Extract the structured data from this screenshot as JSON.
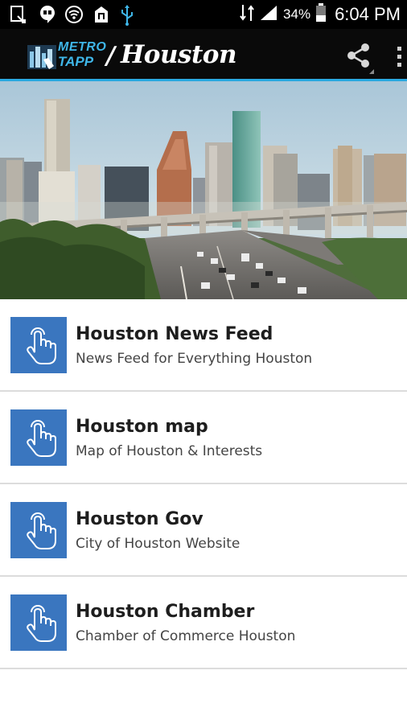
{
  "status_bar": {
    "battery_percent": "34%",
    "time": "6:04 PM",
    "icons": [
      "screenshot-icon",
      "hangouts-icon",
      "wifi-icon",
      "notification-icon",
      "usb-icon",
      "signal-icon",
      "battery-icon"
    ]
  },
  "action_bar": {
    "logo_line1": "METRO",
    "logo_line2": "TAPP",
    "separator": "/",
    "city": "Houston",
    "share_icon": "share-icon",
    "overflow_icon": "overflow-menu-icon"
  },
  "hero": {
    "description_icon": "houston-skyline-image"
  },
  "items": [
    {
      "title": "Houston News Feed",
      "subtitle": "News Feed for Everything Houston",
      "icon": "hand-tap-icon"
    },
    {
      "title": "Houston map",
      "subtitle": "Map of Houston & Interests",
      "icon": "hand-tap-icon"
    },
    {
      "title": "Houston Gov",
      "subtitle": "City of Houston Website",
      "icon": "hand-tap-icon"
    },
    {
      "title": "Houston Chamber",
      "subtitle": "Chamber of Commerce Houston",
      "icon": "hand-tap-icon"
    }
  ],
  "colors": {
    "accent": "#29a9e1",
    "tile": "#3a76bf",
    "bar": "#0a0a0a"
  }
}
